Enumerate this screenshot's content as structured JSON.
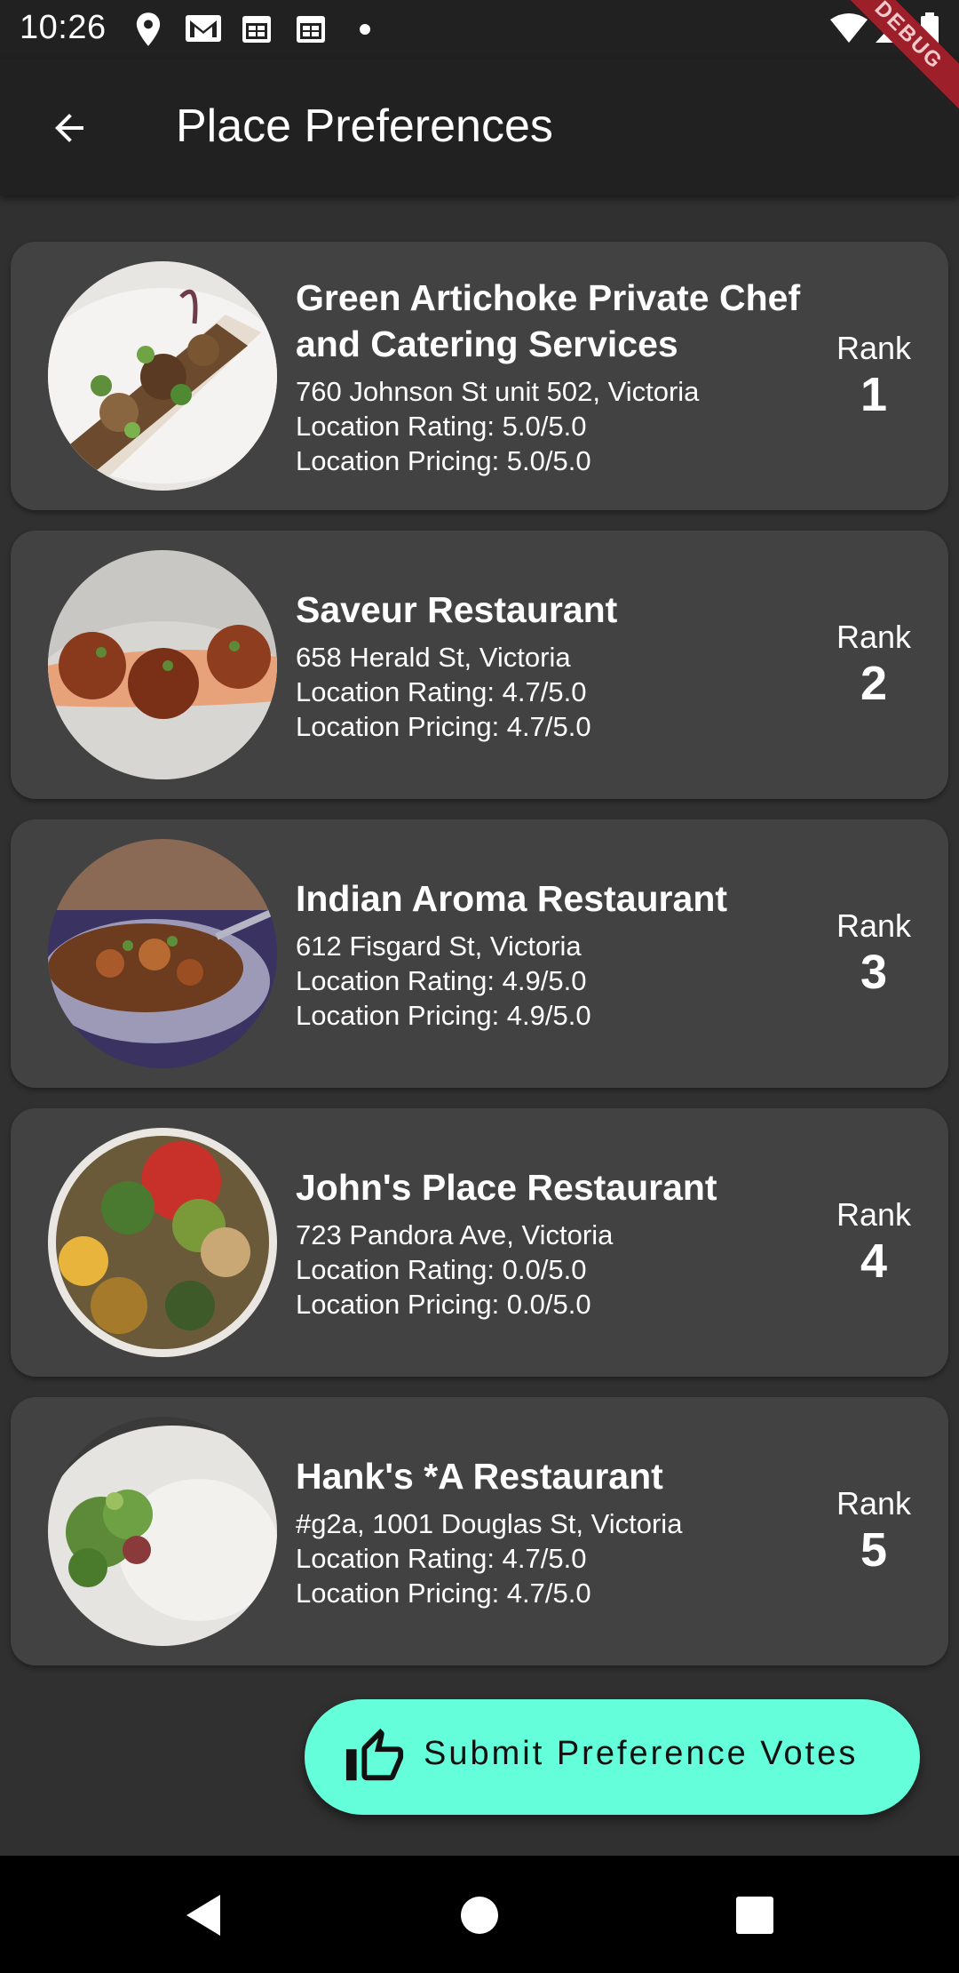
{
  "status_bar": {
    "time": "10:26",
    "debug_label": "DEBUG",
    "icons": [
      "location-icon",
      "gmail-icon",
      "calendar-icon",
      "calendar-icon",
      "dot-icon",
      "wifi-icon",
      "signal-icon",
      "battery-icon"
    ]
  },
  "app_bar": {
    "title": "Place Preferences",
    "back_icon": "arrow-back-icon"
  },
  "places": [
    {
      "name": "Green Artichoke Private Chef and Catering Services",
      "address": "760 Johnson St unit 502, Victoria",
      "rating": "Location Rating: 5.0/5.0",
      "pricing": "Location Pricing: 5.0/5.0",
      "rank_label": "Rank",
      "rank": "1"
    },
    {
      "name": "Saveur Restaurant",
      "address": "658 Herald St, Victoria",
      "rating": "Location Rating: 4.7/5.0",
      "pricing": "Location Pricing: 4.7/5.0",
      "rank_label": "Rank",
      "rank": "2"
    },
    {
      "name": "Indian Aroma Restaurant",
      "address": "612 Fisgard St, Victoria",
      "rating": "Location Rating: 4.9/5.0",
      "pricing": "Location Pricing: 4.9/5.0",
      "rank_label": "Rank",
      "rank": "3"
    },
    {
      "name": "John's Place Restaurant",
      "address": "723 Pandora Ave, Victoria",
      "rating": "Location Rating: 0.0/5.0",
      "pricing": "Location Pricing: 0.0/5.0",
      "rank_label": "Rank",
      "rank": "4"
    },
    {
      "name": "Hank's *A Restaurant",
      "address": "#g2a, 1001 Douglas St, Victoria",
      "rating": "Location Rating: 4.7/5.0",
      "pricing": "Location Pricing: 4.7/5.0",
      "rank_label": "Rank",
      "rank": "5"
    }
  ],
  "submit_button": {
    "label": "Submit Preference Votes",
    "icon": "thumb-up-icon",
    "color": "#64ffda"
  },
  "nav_bar": {
    "icons": [
      "back-triangle-icon",
      "home-circle-icon",
      "recents-square-icon"
    ]
  },
  "colors": {
    "background": "#303030",
    "card": "#424242",
    "app_bar": "#212121",
    "accent": "#64ffda"
  }
}
